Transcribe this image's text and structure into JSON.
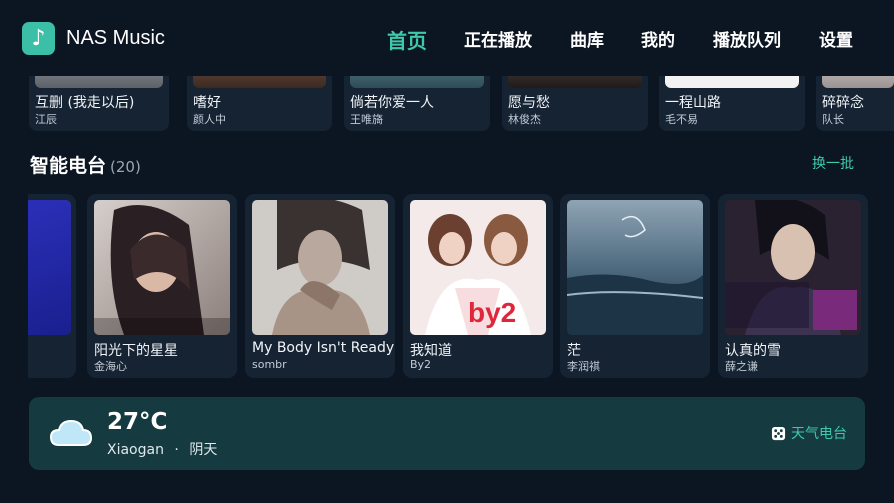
{
  "app": {
    "title": "NAS Music",
    "logo_icon": "music-note-icon",
    "accent": "#3ec9ad"
  },
  "nav": {
    "items": [
      {
        "label": "首页",
        "active": true
      },
      {
        "label": "正在播放"
      },
      {
        "label": "曲库"
      },
      {
        "label": "我的"
      },
      {
        "label": "播放队列"
      },
      {
        "label": "设置"
      }
    ]
  },
  "albums": [
    {
      "title": "互删 (我走以后)",
      "artist": "江辰"
    },
    {
      "title": "嗜好",
      "artist": "颜人中"
    },
    {
      "title": "倘若你爱一人",
      "artist": "王唯旖"
    },
    {
      "title": "愿与愁",
      "artist": "林俊杰"
    },
    {
      "title": "一程山路",
      "artist": "毛不易"
    },
    {
      "title": "碎碎念",
      "artist": "队长"
    }
  ],
  "radio": {
    "title": "智能电台",
    "count": "(20)",
    "refresh_label": "换一批",
    "items": [
      {
        "title": "阳光下的星星",
        "artist": "金海心"
      },
      {
        "title": "My Body Isn't Ready",
        "artist": "sombr"
      },
      {
        "title": "我知道",
        "artist": "By2"
      },
      {
        "title": "茫",
        "artist": "李润祺"
      },
      {
        "title": "认真的雪",
        "artist": "薛之谦"
      }
    ]
  },
  "weather": {
    "temperature": "27°C",
    "city": "Xiaogan",
    "separator": "·",
    "condition": "阴天",
    "radio_label": "天气电台",
    "icon": "cloud-icon",
    "radio_icon": "dice-icon"
  }
}
